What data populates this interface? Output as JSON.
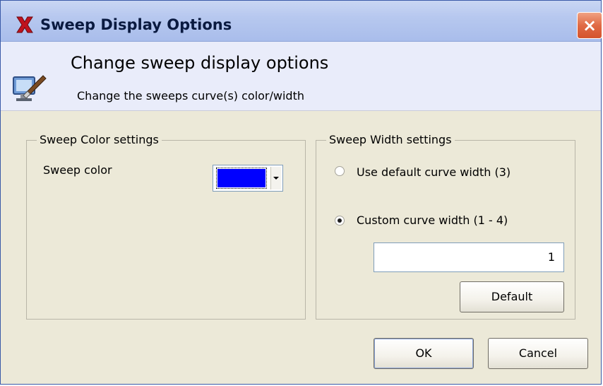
{
  "window": {
    "title": "Sweep Display Options",
    "close_glyph": "×",
    "icon": "app-x-logo-icon"
  },
  "header": {
    "title": "Change sweep display options",
    "subtitle": "Change the sweeps curve(s) color/width",
    "icon": "monitor-brush-icon"
  },
  "color_group": {
    "legend": "Sweep Color settings",
    "color_label": "Sweep color",
    "color_value": "#0000ff"
  },
  "width_group": {
    "legend": "Sweep Width settings",
    "option_default": "Use default curve width (3)",
    "option_custom": "Custom curve width (1 - 4)",
    "selected": "custom",
    "width_value": "1",
    "default_button": "Default"
  },
  "footer": {
    "ok_button": "OK",
    "cancel_button": "Cancel"
  }
}
